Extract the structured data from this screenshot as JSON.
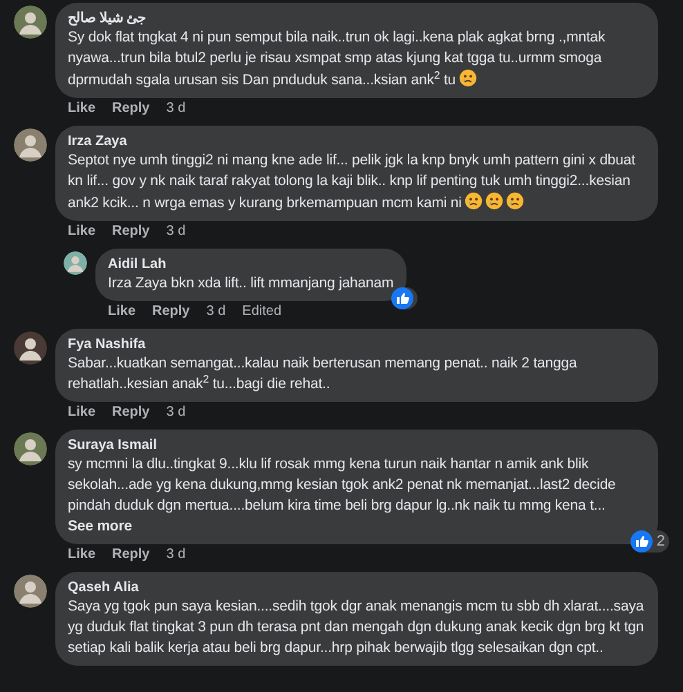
{
  "comments": [
    {
      "author": "جئ شيلا صالح",
      "text": "Sy dok flat tngkat 4 ni pun semput bila naik..trun ok lagi..kena plak agkat brng .,mntak nyawa...trun bila btul2 perlu je risau xsmpat smp atas kjung kat tgga tu..urmm smoga dprmudah sgala urusan sis Dan pnduduk sana...ksian ank$^{2}$ tu",
      "emojis": [
        {
          "kind": "sad"
        }
      ],
      "actions": [
        "Like",
        "Reply"
      ],
      "time": "3 d"
    },
    {
      "author": "Irza Zaya",
      "text": "Septot nye umh tinggi2 ni mang kne ade lif... pelik jgk la knp bnyk umh pattern gini x dbuat kn lif... gov y nk naik taraf rakyat tolong la kaji blik.. knp lif penting tuk umh tinggi2...kesian ank2 kcik... n wrga emas y kurang brkemampuan mcm kami ni",
      "emojis": [
        {
          "kind": "sad"
        },
        {
          "kind": "sad"
        },
        {
          "kind": "sad"
        }
      ],
      "actions": [
        "Like",
        "Reply"
      ],
      "time": "3 d",
      "replies": [
        {
          "author": "Aidil Lah",
          "text": "Irza Zaya bkn xda lift.. lift mmanjang jahanam",
          "reaction": {
            "kind": "like"
          },
          "actions": [
            "Like",
            "Reply"
          ],
          "time": "3 d",
          "edited": "Edited"
        }
      ]
    },
    {
      "author": "Fya Nashifa",
      "text": "Sabar...kuatkan semangat...kalau naik berterusan memang penat.. naik 2 tangga rehatlah..kesian anak$^{2}$ tu...bagi die rehat..",
      "actions": [
        "Like",
        "Reply"
      ],
      "time": "3 d"
    },
    {
      "author": "Suraya Ismail",
      "text": "sy mcmni la dlu..tingkat 9...klu lif rosak mmg kena turun naik hantar n amik ank blik sekolah...ade yg kena dukung,mmg kesian tgok ank2 penat nk memanjat...last2 decide pindah duduk dgn mertua....belum kira time beli brg dapur lg..nk naik tu mmg kena t...",
      "see_more": "See more",
      "reaction": {
        "kind": "like",
        "count": "2"
      },
      "actions": [
        "Like",
        "Reply"
      ],
      "time": "3 d"
    },
    {
      "author": "Qaseh Alia",
      "text": "Saya yg tgok pun saya kesian....sedih tgok dgr anak menangis mcm tu sbb dh xlarat....saya yg duduk flat tingkat 3 pun dh terasa pnt dan mengah dgn dukung anak kecik dgn brg kt tgn setiap kali balik kerja atau beli brg dapur...hrp pihak berwajib tlgg selesaikan dgn cpt.."
    }
  ]
}
